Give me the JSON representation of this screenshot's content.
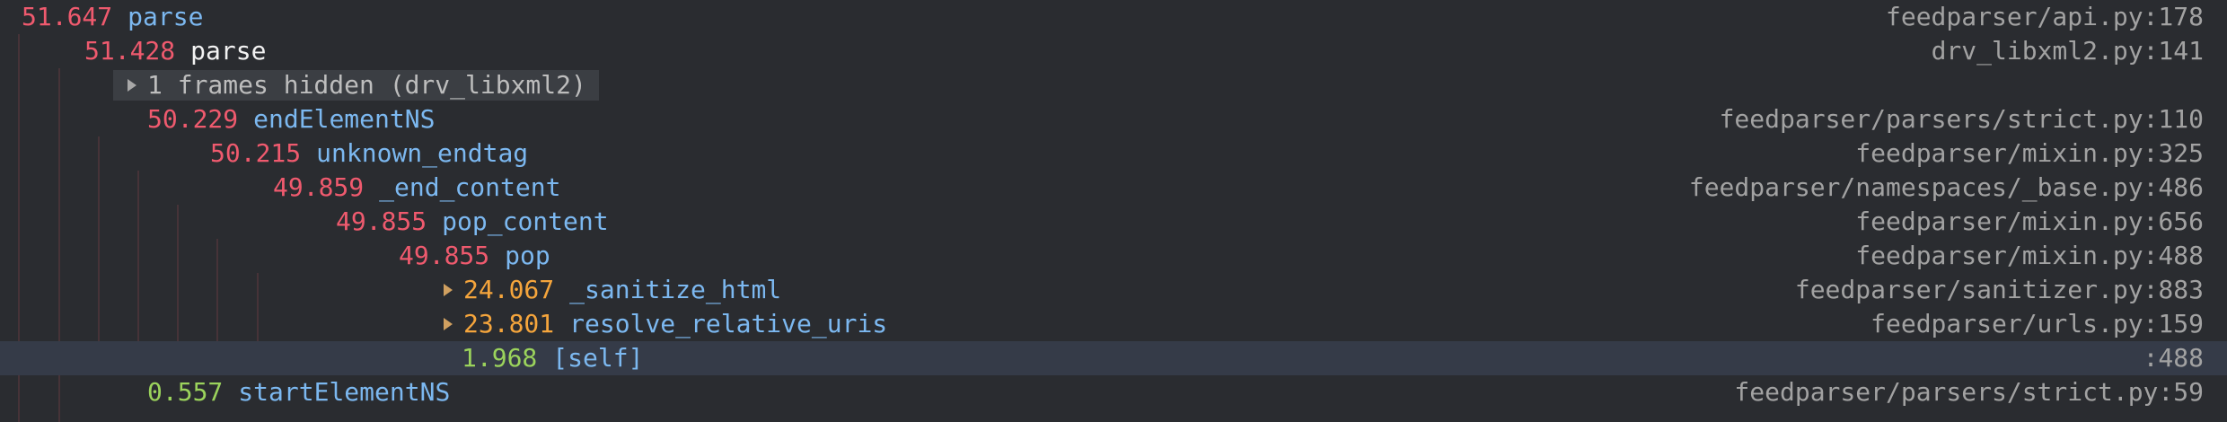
{
  "rows": [
    {
      "time": "51.647",
      "time_color": "red",
      "function": "parse",
      "location": "feedparser/api.py:178"
    },
    {
      "time": "51.428",
      "time_color": "red",
      "function": "parse",
      "location": "drv_libxml2.py:141"
    },
    {
      "hidden_label": "1 frames hidden (drv_libxml2)"
    },
    {
      "time": "50.229",
      "time_color": "red",
      "function": "endElementNS",
      "location": "feedparser/parsers/strict.py:110"
    },
    {
      "time": "50.215",
      "time_color": "red",
      "function": "unknown_endtag",
      "location": "feedparser/mixin.py:325"
    },
    {
      "time": "49.859",
      "time_color": "red",
      "function": "_end_content",
      "location": "feedparser/namespaces/_base.py:486"
    },
    {
      "time": "49.855",
      "time_color": "red",
      "function": "pop_content",
      "location": "feedparser/mixin.py:656"
    },
    {
      "time": "49.855",
      "time_color": "red",
      "function": "pop",
      "location": "feedparser/mixin.py:488"
    },
    {
      "time": "24.067",
      "time_color": "orange",
      "function": "_sanitize_html",
      "location": "feedparser/sanitizer.py:883"
    },
    {
      "time": "23.801",
      "time_color": "orange",
      "function": "resolve_relative_uris",
      "location": "feedparser/urls.py:159"
    },
    {
      "time": "1.968",
      "time_color": "green",
      "function": "[self]",
      "location": ":488"
    },
    {
      "time": "0.557",
      "time_color": "green",
      "function": "startElementNS",
      "location": "feedparser/parsers/strict.py:59"
    }
  ],
  "colors": {
    "background": "#2a2c30",
    "selected_row": "#353b48",
    "time_red": "#ef5a6e",
    "time_orange": "#f5a53c",
    "time_green": "#9bd35c",
    "function": "#7cb8f0",
    "location": "#a2a2a2"
  },
  "icons": {
    "expand": "chevron-right-icon"
  }
}
